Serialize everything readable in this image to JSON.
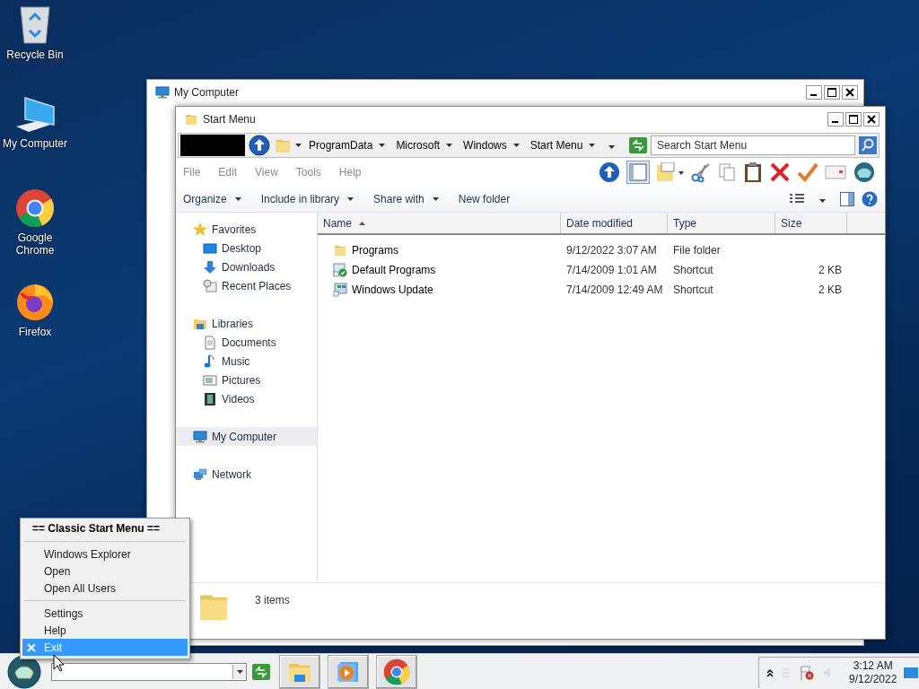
{
  "desktop_icons": [
    {
      "label": "Recycle Bin",
      "kind": "recycle"
    },
    {
      "label": "My Computer",
      "kind": "computer"
    },
    {
      "label": "Google Chrome",
      "kind": "chrome"
    },
    {
      "label": "Firefox",
      "kind": "firefox"
    }
  ],
  "background_window": {
    "title": "My Computer"
  },
  "explorer": {
    "title": "Start Menu",
    "breadcrumb": [
      "ProgramData",
      "Microsoft",
      "Windows",
      "Start Menu"
    ],
    "search": {
      "placeholder": "Search Start Menu"
    },
    "menu": [
      "File",
      "Edit",
      "View",
      "Tools",
      "Help"
    ],
    "commands": [
      {
        "label": "Organize",
        "dropdown": true
      },
      {
        "label": "Include in library",
        "dropdown": true
      },
      {
        "label": "Share with",
        "dropdown": true
      },
      {
        "label": "New folder",
        "dropdown": false
      }
    ],
    "nav": [
      {
        "label": "Favorites",
        "selected": false,
        "children": [
          {
            "label": "Desktop",
            "selected": false
          },
          {
            "label": "Downloads",
            "selected": false
          },
          {
            "label": "Recent Places",
            "selected": false
          }
        ]
      },
      {
        "label": "Libraries",
        "selected": false,
        "children": [
          {
            "label": "Documents",
            "selected": false
          },
          {
            "label": "Music",
            "selected": false
          },
          {
            "label": "Pictures",
            "selected": false
          },
          {
            "label": "Videos",
            "selected": false
          }
        ]
      },
      {
        "label": "My Computer",
        "selected": true
      },
      {
        "label": "Network",
        "selected": false
      }
    ],
    "columns": [
      {
        "label": "Name",
        "sorted": true
      },
      {
        "label": "Date modified",
        "sorted": false
      },
      {
        "label": "Type",
        "sorted": false
      },
      {
        "label": "Size",
        "sorted": false
      }
    ],
    "rows": [
      {
        "kind": "folder",
        "name": "Programs",
        "date": "9/12/2022 3:07 AM",
        "type": "File folder"
      },
      {
        "kind": "defaults",
        "name": "Default Programs",
        "date": "7/14/2009 1:01 AM",
        "type": "Shortcut",
        "size": "2 KB"
      },
      {
        "kind": "update",
        "name": "Windows Update",
        "date": "7/14/2009 12:49 AM",
        "type": "Shortcut",
        "size": "2 KB"
      }
    ],
    "status": "3 items"
  },
  "context_menu": {
    "items": [
      {
        "kind": "header",
        "label": "== Classic Start Menu =="
      },
      {
        "kind": "separator"
      },
      {
        "kind": "item",
        "label": "Windows Explorer",
        "selected": false
      },
      {
        "kind": "item",
        "label": "Open",
        "selected": false
      },
      {
        "kind": "item",
        "label": "Open All Users",
        "selected": false
      },
      {
        "kind": "separator"
      },
      {
        "kind": "item",
        "label": "Settings",
        "selected": false
      },
      {
        "kind": "item",
        "label": "Help",
        "selected": false
      },
      {
        "kind": "item",
        "label": "Exit",
        "selected": true
      }
    ]
  },
  "taskbar": {
    "tasks": [
      {
        "kind": "explorer"
      },
      {
        "kind": "media"
      },
      {
        "kind": "chrome"
      }
    ],
    "clock": {
      "time": "3:12 AM",
      "date": "9/12/2022"
    }
  }
}
